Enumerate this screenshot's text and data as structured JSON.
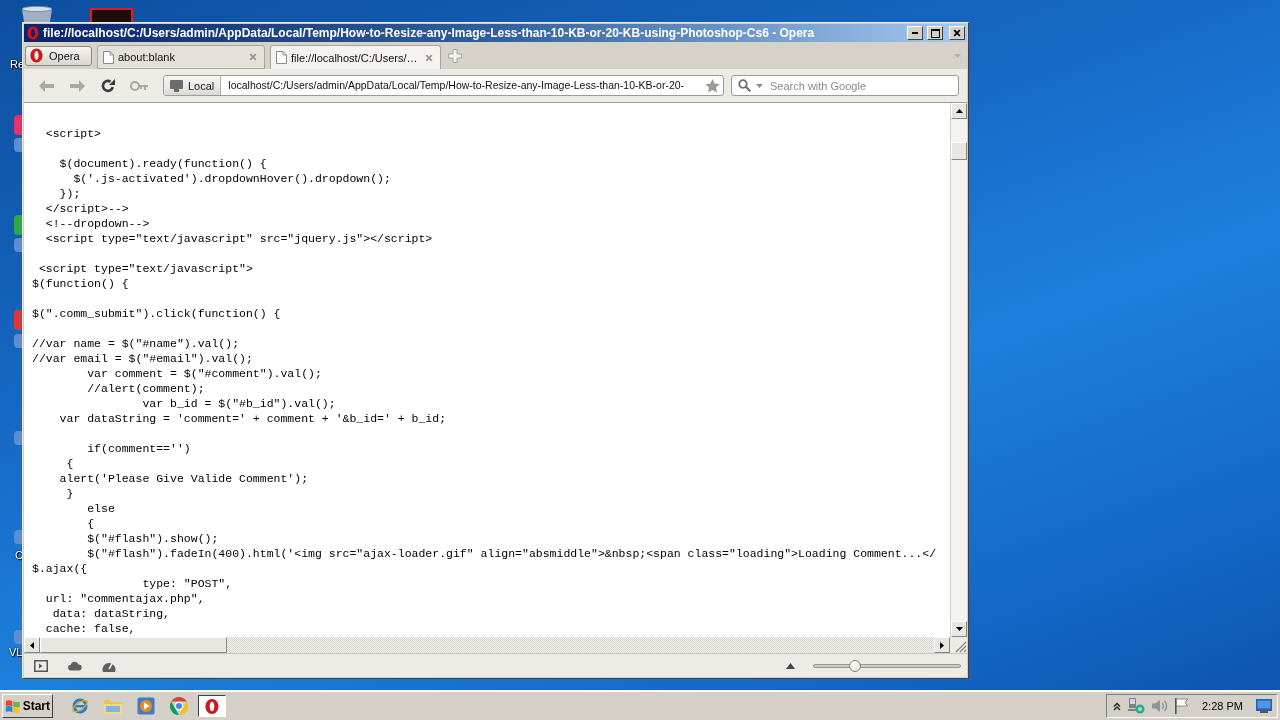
{
  "desktop": {
    "icon_labels": [
      "Re",
      "C",
      "VL"
    ]
  },
  "window": {
    "title": "file://localhost/C:/Users/admin/AppData/Local/Temp/How-to-Resize-any-Image-Less-than-10-KB-or-20-KB-using-Photoshop-Cs6 - Opera"
  },
  "menu_button": {
    "label": "Opera"
  },
  "tabs": [
    {
      "title": "about:blank",
      "selected": false
    },
    {
      "title": "file://localhost/C:/Users/…",
      "selected": true
    }
  ],
  "toolbar": {
    "nav_buttons": [
      {
        "kind": "back",
        "disabled": true
      },
      {
        "kind": "forward",
        "disabled": true
      },
      {
        "kind": "reload",
        "disabled": false
      },
      {
        "kind": "key",
        "disabled": true
      }
    ],
    "address": {
      "badge": "Local",
      "value": "localhost/C:/Users/admin/AppData/Local/Temp/How-to-Resize-any-Image-Less-than-10-KB-or-20-"
    },
    "search": {
      "placeholder": "Search with Google"
    }
  },
  "content": {
    "blocks": [
      [
        "  <script>"
      ],
      [
        "    $(document).ready(function() {",
        "      $('.js-activated').dropdownHover().dropdown();",
        "    });",
        "  </script>-->",
        "  <!--dropdown-->",
        "  <script type=\"text/javascript\" src=\"jquery.js\"></script>"
      ],
      [
        " <script type=\"text/javascript\">",
        "$(function() {"
      ],
      [
        "$(\".comm_submit\").click(function() {"
      ],
      [
        "//var name = $(\"#name\").val();",
        "//var email = $(\"#email\").val();",
        "        var comment = $(\"#comment\").val();",
        "        //alert(comment);",
        "                var b_id = $(\"#b_id\").val();",
        "    var dataString = 'comment=' + comment + '&b_id=' + b_id;"
      ],
      [
        "        if(comment=='')",
        "     {",
        "    alert('Please Give Valide Comment');",
        "     }",
        "        else",
        "        {",
        "        $(\"#flash\").show();",
        "        $(\"#flash\").fadeIn(400).html('<img src=\"ajax-loader.gif\" align=\"absmiddle\">&nbsp;<span class=\"loading\">Loading Comment...</",
        "$.ajax({",
        "                type: \"POST\",",
        "  url: \"commentajax.php\",",
        "   data: dataString,",
        "  cache: false,"
      ]
    ]
  },
  "status_bar": {
    "zoom": {
      "level": 0.28
    }
  },
  "taskbar": {
    "start": "Start",
    "apps": [
      {
        "kind": "e",
        "selected": false
      },
      {
        "kind": "folder",
        "selected": false
      },
      {
        "kind": "player",
        "selected": false
      },
      {
        "kind": "ring",
        "selected": false
      },
      {
        "kind": "o",
        "selected": true
      }
    ],
    "clock": "2:28 PM"
  }
}
